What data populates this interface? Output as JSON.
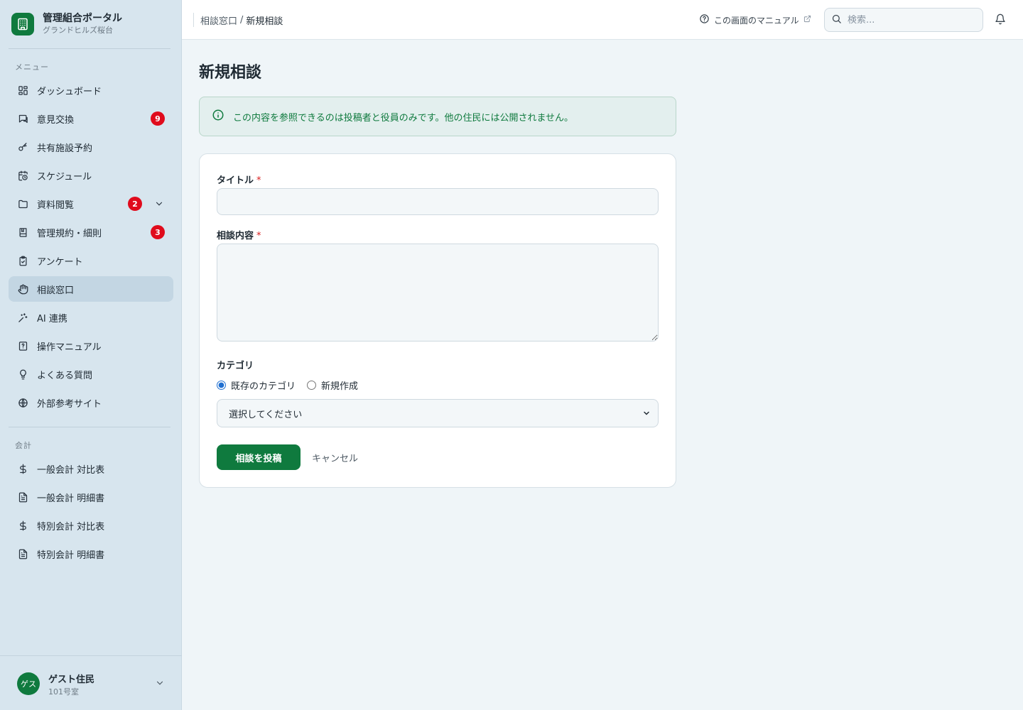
{
  "brand": {
    "title": "管理組合ポータル",
    "subtitle": "グランドヒルズ桜台"
  },
  "sidebar": {
    "menu_label": "メニュー",
    "items": [
      {
        "label": "ダッシュボード",
        "icon": "dashboard-icon"
      },
      {
        "label": "意見交換",
        "icon": "chat-icon",
        "badge": "9"
      },
      {
        "label": "共有施設予約",
        "icon": "key-icon"
      },
      {
        "label": "スケジュール",
        "icon": "calendar-clock-icon"
      },
      {
        "label": "資料閲覧",
        "icon": "folder-icon",
        "badge": "2",
        "expandable": true
      },
      {
        "label": "管理規約・細則",
        "icon": "book-icon",
        "badge": "3"
      },
      {
        "label": "アンケート",
        "icon": "clipboard-icon"
      },
      {
        "label": "相談窓口",
        "icon": "hand-icon",
        "active": true
      },
      {
        "label": "AI 連携",
        "icon": "sparkles-icon"
      },
      {
        "label": "操作マニュアル",
        "icon": "manual-icon"
      },
      {
        "label": "よくある質問",
        "icon": "lightbulb-icon"
      },
      {
        "label": "外部参考サイト",
        "icon": "globe-icon"
      }
    ],
    "accounting_label": "会計",
    "accounting_items": [
      {
        "label": "一般会計 対比表",
        "icon": "dollar-icon"
      },
      {
        "label": "一般会計 明細書",
        "icon": "document-icon"
      },
      {
        "label": "特別会計 対比表",
        "icon": "dollar-icon"
      },
      {
        "label": "特別会計 明細書",
        "icon": "document-icon"
      }
    ]
  },
  "user": {
    "avatar": "ゲス",
    "name": "ゲスト住民",
    "room": "101号室"
  },
  "header": {
    "breadcrumb_parent": "相談窓口",
    "breadcrumb_sep": "/",
    "breadcrumb_current": "新規相談",
    "manual_link": "この画面のマニュアル",
    "search_placeholder": "検索..."
  },
  "page": {
    "title": "新規相談",
    "notice": "この内容を参照できるのは投稿者と役員のみです。他の住民には公開されません。"
  },
  "form": {
    "title_label": "タイトル",
    "title_value": "",
    "content_label": "相談内容",
    "content_value": "",
    "required_mark": "*",
    "category_label": "カテゴリ",
    "radio_existing": "既存のカテゴリ",
    "radio_new": "新規作成",
    "select_value": "選択してください",
    "submit_label": "相談を投稿",
    "cancel_label": "キャンセル"
  },
  "colors": {
    "brand": "#0f7a3e",
    "badge": "#e00b1c",
    "sidebar_bg": "#d7e5ee",
    "page_bg": "#eff5f8"
  }
}
